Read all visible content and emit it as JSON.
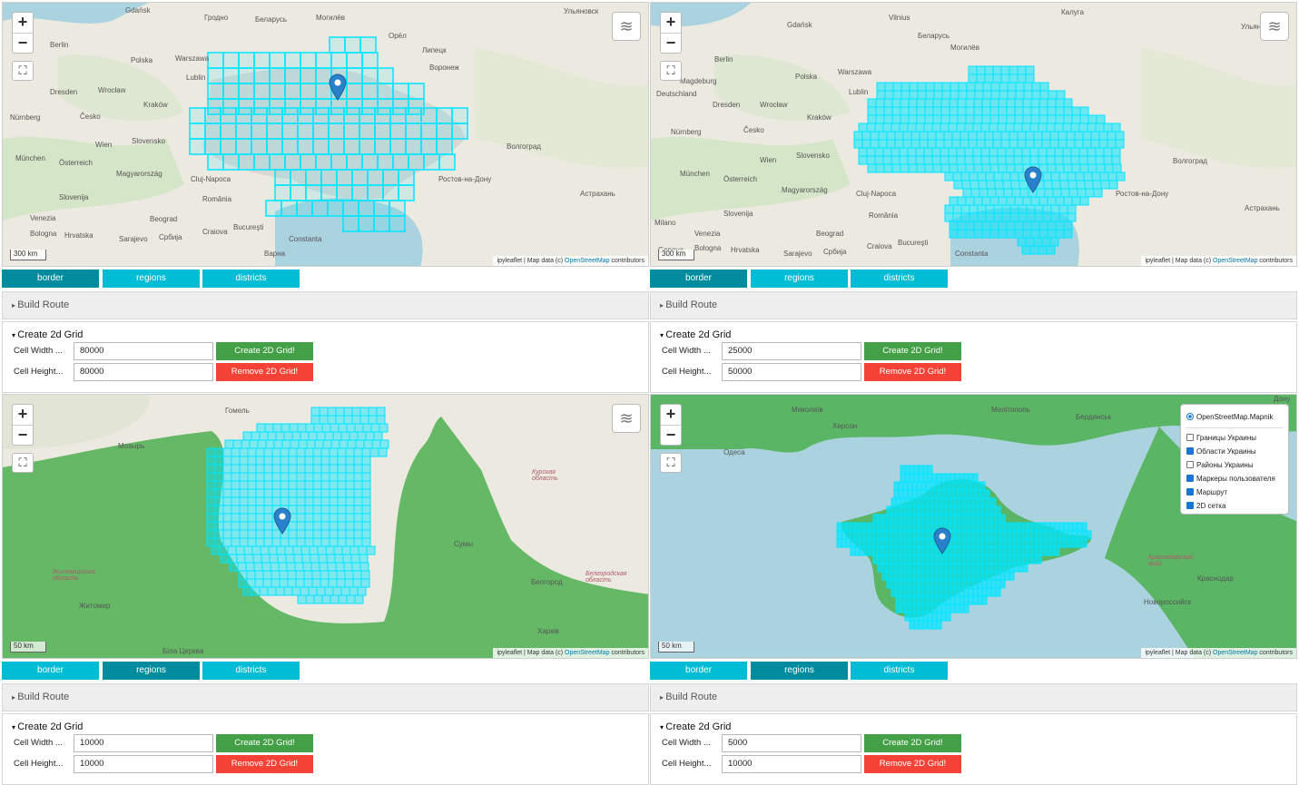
{
  "panels": [
    {
      "map": {
        "zoom_in": "+",
        "zoom_out": "−",
        "fullscreen": "⛶",
        "layers": "≋",
        "scale": "300 km",
        "attribution_prefix": "ipyleaflet | Map data (c) ",
        "attribution_link": "OpenStreetMap",
        "attribution_suffix": " contributors",
        "labels": [
          "Gdańsk",
          "Гродно",
          "Беларусь",
          "Могилёв",
          "Ульяновск",
          "Berlin",
          "Polska",
          "Warszawa",
          "Lublin",
          "Орёл",
          "Липецк",
          "Воронеж",
          "Dresden",
          "Wrocław",
          "Kraków",
          "Česko",
          "Wien",
          "Slovensko",
          "München",
          "Österreich",
          "Magyarország",
          "Cluj-Napoca",
          "România",
          "Slovenija",
          "Beograd",
          "Bucureşti",
          "Constanta",
          "Варна",
          "Волгоград",
          "Астрахань",
          "Ростов-на-Дону",
          "Nürnberg",
          "Venezia",
          "Bologna",
          "Hrvatska",
          "Sarajevo",
          "Србија",
          "Craiova"
        ]
      },
      "tabs": [
        "border",
        "regions",
        "districts"
      ],
      "active_tab": 0,
      "route_label": "Build Route",
      "grid": {
        "title": "Create 2d Grid",
        "cell_width_label": "Cell Width ...",
        "cell_width": "80000",
        "cell_height_label": "Cell Height...",
        "cell_height": "80000",
        "create": "Create 2D Grid!",
        "remove": "Remove 2D Grid!"
      }
    },
    {
      "map": {
        "zoom_in": "+",
        "zoom_out": "−",
        "fullscreen": "⛶",
        "layers": "≋",
        "scale": "300 km",
        "attribution_prefix": "ipyleaflet | Map data (c) ",
        "attribution_link": "OpenStreetMap",
        "attribution_suffix": " contributors",
        "labels": [
          "Gdańsk",
          "Vilnius",
          "Беларусь",
          "Могилёв",
          "Калуга",
          "Ульяновск",
          "Berlin",
          "Polska",
          "Warszawa",
          "Lublin",
          "Magdeburg",
          "Deutschland",
          "Dresden",
          "Wrocław",
          "Kraków",
          "Česko",
          "Wien",
          "Slovensko",
          "München",
          "Österreich",
          "Magyarország",
          "Cluj-Napoca",
          "România",
          "Slovenija",
          "Beograd",
          "Bucureşti",
          "Constanta",
          "Волгоград",
          "Астрахань",
          "Ростов-на-Дону",
          "Nürnberg",
          "Venezia",
          "Bologna",
          "Hrvatska",
          "Sarajevo",
          "Србија",
          "Craiova",
          "Milano",
          "Genova"
        ]
      },
      "tabs": [
        "border",
        "regions",
        "districts"
      ],
      "active_tab": 0,
      "route_label": "Build Route",
      "grid": {
        "title": "Create 2d Grid",
        "cell_width_label": "Cell Width ...",
        "cell_width": "25000",
        "cell_height_label": "Cell Height...",
        "cell_height": "50000",
        "create": "Create 2D Grid!",
        "remove": "Remove 2D Grid!"
      }
    },
    {
      "map": {
        "zoom_in": "+",
        "zoom_out": "−",
        "fullscreen": "⛶",
        "layers": "≋",
        "scale": "50 km",
        "attribution_prefix": "ipyleaflet | Map data (c) ",
        "attribution_link": "OpenStreetMap",
        "attribution_suffix": " contributors",
        "labels": [
          "Гомель",
          "Мозырь",
          "Курская область",
          "Сумы",
          "Белгород",
          "Житомир",
          "Харків",
          "Біла Церква",
          "Житомирська область",
          "Белгородская область"
        ]
      },
      "tabs": [
        "border",
        "regions",
        "districts"
      ],
      "active_tab": 1,
      "route_label": "Build Route",
      "grid": {
        "title": "Create 2d Grid",
        "cell_width_label": "Cell Width ...",
        "cell_width": "10000",
        "cell_height_label": "Cell Height...",
        "cell_height": "10000",
        "create": "Create 2D Grid!",
        "remove": "Remove 2D Grid!"
      }
    },
    {
      "map": {
        "zoom_in": "+",
        "zoom_out": "−",
        "fullscreen": "⛶",
        "scale": "50 km",
        "attribution_prefix": "ipyleaflet | Map data (c) ",
        "attribution_link": "OpenStreetMap",
        "attribution_suffix": " contributors",
        "labels": [
          "Миколаїв",
          "Мелітополь",
          "Херсон",
          "Одеса",
          "Бердянськ",
          "Краснодар",
          "Новороссийск",
          "Краснодарский край",
          "Дону"
        ],
        "layer_control": {
          "base": "OpenStreetMap.Mapnik",
          "overlays": [
            {
              "label": "Границы Украины",
              "checked": false
            },
            {
              "label": "Области Украины",
              "checked": true
            },
            {
              "label": "Районы Украины",
              "checked": false
            },
            {
              "label": "Маркеры пользователя",
              "checked": true
            },
            {
              "label": "Маршрут",
              "checked": true
            },
            {
              "label": "2D сетка",
              "checked": true
            }
          ]
        }
      },
      "tabs": [
        "border",
        "regions",
        "districts"
      ],
      "active_tab": 1,
      "route_label": "Build Route",
      "grid": {
        "title": "Create 2d Grid",
        "cell_width_label": "Cell Width ...",
        "cell_width": "5000",
        "cell_height_label": "Cell Height...",
        "cell_height": "10000",
        "create": "Create 2D Grid!",
        "remove": "Remove 2D Grid!"
      }
    }
  ],
  "colors": {
    "grid": "#00e5ff",
    "tab": "#00bcd4",
    "tab_active": "#008c9e",
    "create": "#43a047",
    "remove": "#f44336",
    "marker": "#2a81cb"
  }
}
